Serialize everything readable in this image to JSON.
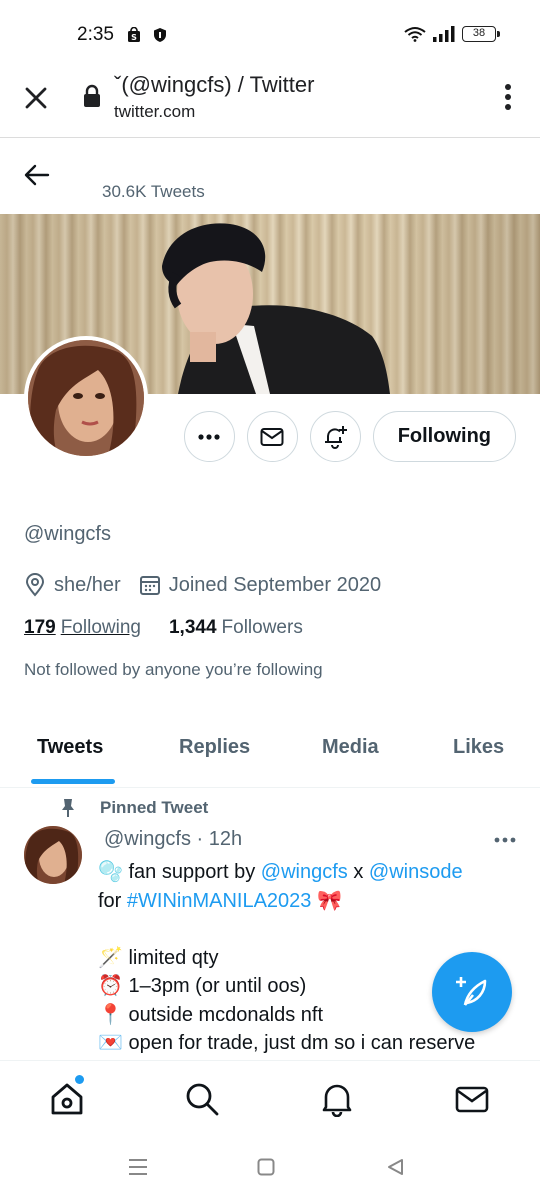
{
  "status_bar": {
    "time": "2:35",
    "battery": "38"
  },
  "browser": {
    "title": "ˇ(@wingcfs) / Twitter",
    "url": "twitter.com"
  },
  "profile": {
    "tweet_count": "30.6K Tweets",
    "handle": "@wingcfs",
    "pronouns": "she/her",
    "joined": "Joined September 2020",
    "following_count": "179",
    "following_label": "Following",
    "followers_count": "1,344",
    "followers_label": "Followers",
    "not_followed": "Not followed by anyone you’re following",
    "follow_button": "Following"
  },
  "tabs": [
    {
      "label": "Tweets"
    },
    {
      "label": "Replies"
    },
    {
      "label": "Media"
    },
    {
      "label": "Likes"
    }
  ],
  "pinned_tweet": {
    "pinned_label": "Pinned Tweet",
    "header": "@wingcfs · 12h",
    "line1_prefix": "🫧 fan support by ",
    "line1_link1": "@wingcfs",
    "line1_mid": " x ",
    "line1_link2": "@winsode",
    "line2_prefix": "for ",
    "line2_hashtag": "#WINinMANILA2023",
    "line2_suffix": " 🎀",
    "line3": "🪄 limited qty",
    "line4": "⏰ 1–3pm (or until oos)",
    "line5": "📍 outside mcdonalds nft",
    "line6": "💌 open for trade, just dm so i can reserve"
  },
  "colors": {
    "accent": "#1d9bf0",
    "text": "#0f1419",
    "secondary": "#536471"
  }
}
